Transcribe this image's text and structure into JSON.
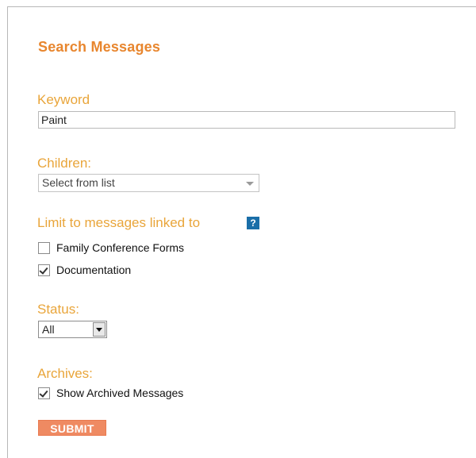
{
  "form": {
    "title": "Search Messages",
    "keyword": {
      "label": "Keyword",
      "value": "Paint"
    },
    "children": {
      "label": "Children:",
      "selected": "Select from list"
    },
    "limit": {
      "label": "Limit to messages linked to",
      "help_icon_text": "?",
      "options": [
        {
          "label": "Family Conference Forms",
          "checked": false
        },
        {
          "label": "Documentation",
          "checked": true
        }
      ]
    },
    "status": {
      "label": "Status:",
      "selected": "All"
    },
    "archives": {
      "label": "Archives:",
      "option": {
        "label": "Show Archived Messages",
        "checked": true
      }
    },
    "submit_label": "SUBMIT"
  },
  "colors": {
    "title": "#e8862e",
    "label": "#e9a53a",
    "submit_bg": "#ef8a62",
    "help_icon_bg": "#1a6ea8"
  }
}
